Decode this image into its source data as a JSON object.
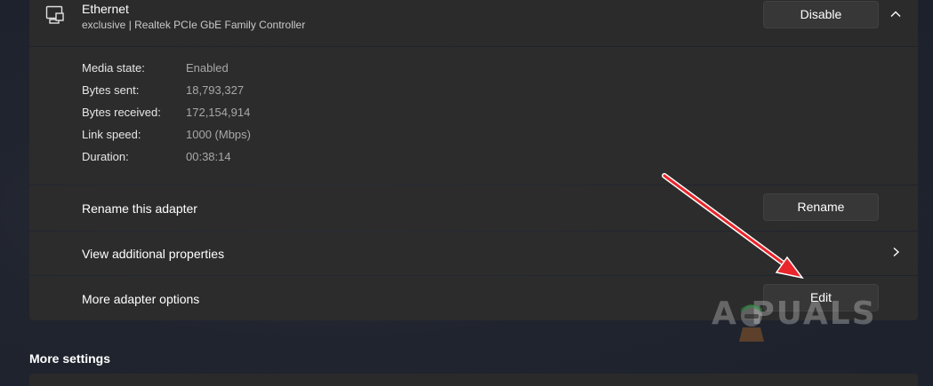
{
  "adapter": {
    "name": "Ethernet",
    "description": "exclusive | Realtek PCIe GbE Family Controller",
    "disable_label": "Disable"
  },
  "details": [
    {
      "label": "Media state:",
      "value": "Enabled"
    },
    {
      "label": "Bytes sent:",
      "value": "18,793,327"
    },
    {
      "label": "Bytes received:",
      "value": "172,154,914"
    },
    {
      "label": "Link speed:",
      "value": "1000 (Mbps)"
    },
    {
      "label": "Duration:",
      "value": "00:38:14"
    }
  ],
  "rows": {
    "rename": {
      "label": "Rename this adapter",
      "button": "Rename"
    },
    "properties": {
      "label": "View additional properties"
    },
    "more": {
      "label": "More adapter options",
      "button": "Edit"
    }
  },
  "more_settings": {
    "title": "More settings"
  },
  "watermark": {
    "text": "A  PUALS"
  },
  "colors": {
    "annotation_arrow": "#e8262b",
    "card": "#2c2c2c",
    "button": "#373737"
  },
  "icons": {
    "adapter": "ethernet-adapter-icon",
    "collapse": "chevron-up-icon",
    "expand": "chevron-right-icon"
  }
}
